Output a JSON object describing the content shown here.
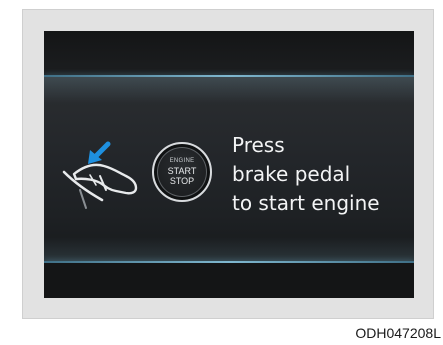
{
  "display": {
    "start_button": {
      "engine_label": "ENGINE",
      "start_label": "START",
      "stop_label": "STOP"
    },
    "message_lines": [
      "Press",
      "brake pedal",
      "to start engine"
    ],
    "icons": [
      "brake-pedal-icon",
      "arrow-icon",
      "engine-start-stop-button-icon"
    ],
    "colors": {
      "screen_background": "#111213",
      "accent_arrow": "#1e90e0",
      "glow_line": "#7fb7cf",
      "text": "#f3f4f5"
    }
  },
  "figure_code": "ODH047208L"
}
